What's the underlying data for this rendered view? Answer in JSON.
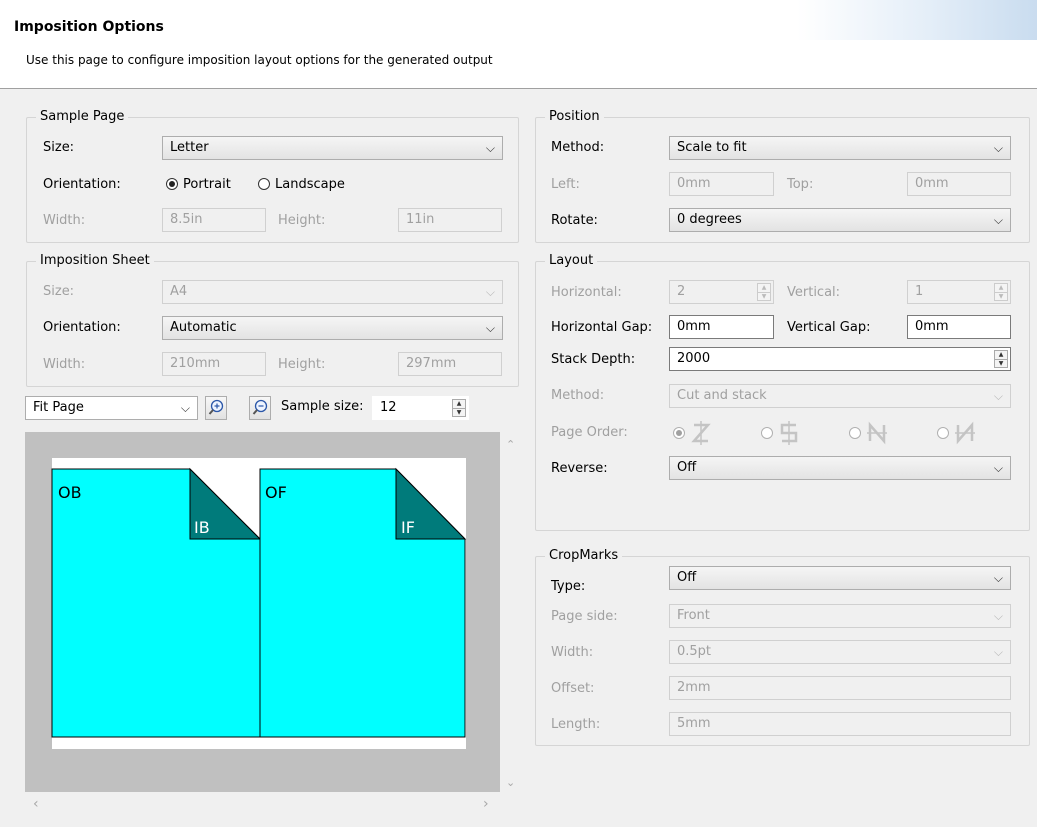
{
  "header": {
    "title": "Imposition Options",
    "description": "Use this page to configure imposition layout options for the generated output"
  },
  "sample_page": {
    "title": "Sample Page",
    "size_label": "Size:",
    "size_value": "Letter",
    "orientation_label": "Orientation:",
    "portrait_label": "Portrait",
    "landscape_label": "Landscape",
    "width_label": "Width:",
    "width_value": "8.5in",
    "height_label": "Height:",
    "height_value": "11in"
  },
  "imposition_sheet": {
    "title": "Imposition Sheet",
    "size_label": "Size:",
    "size_value": "A4",
    "orientation_label": "Orientation:",
    "orientation_value": "Automatic",
    "width_label": "Width:",
    "width_value": "210mm",
    "height_label": "Height:",
    "height_value": "297mm"
  },
  "preview": {
    "zoom_value": "Fit Page",
    "sample_size_label": "Sample size:",
    "sample_size_value": "12",
    "page1_front": "OB",
    "page1_back": "IB",
    "page2_front": "OF",
    "page2_back": "IF",
    "page_color": "#00ffff",
    "fold_color": "#007b7b"
  },
  "position": {
    "title": "Position",
    "method_label": "Method:",
    "method_value": "Scale to fit",
    "left_label": "Left:",
    "left_value": "0mm",
    "top_label": "Top:",
    "top_value": "0mm",
    "rotate_label": "Rotate:",
    "rotate_value": "0 degrees"
  },
  "layout": {
    "title": "Layout",
    "horizontal_label": "Horizontal:",
    "horizontal_value": "2",
    "vertical_label": "Vertical:",
    "vertical_value": "1",
    "hgap_label": "Horizontal Gap:",
    "hgap_value": "0mm",
    "vgap_label": "Vertical Gap:",
    "vgap_value": "0mm",
    "stack_label": "Stack Depth:",
    "stack_value": "2000",
    "method_label": "Method:",
    "method_value": "Cut and stack",
    "page_order_label": "Page Order:",
    "reverse_label": "Reverse:",
    "reverse_value": "Off"
  },
  "cropmarks": {
    "title": "CropMarks",
    "type_label": "Type:",
    "type_value": "Off",
    "page_side_label": "Page side:",
    "page_side_value": "Front",
    "width_label": "Width:",
    "width_value": "0.5pt",
    "offset_label": "Offset:",
    "offset_value": "2mm",
    "length_label": "Length:",
    "length_value": "5mm"
  }
}
